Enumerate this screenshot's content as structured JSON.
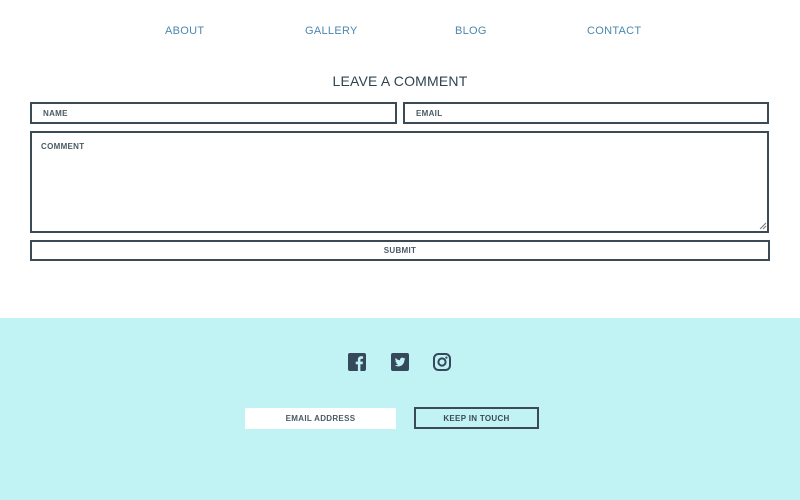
{
  "nav": {
    "items": [
      {
        "label": "ABOUT"
      },
      {
        "label": "GALLERY"
      },
      {
        "label": "BLOG"
      },
      {
        "label": "CONTACT"
      }
    ]
  },
  "comment_form": {
    "title": "LEAVE A COMMENT",
    "name_placeholder": "NAME",
    "email_placeholder": "EMAIL",
    "comment_placeholder": "COMMENT",
    "submit_label": "SUBMIT"
  },
  "footer": {
    "social_icons": [
      "facebook-icon",
      "twitter-icon",
      "instagram-icon"
    ],
    "email_placeholder": "EMAIL ADDRESS",
    "keep_in_touch_label": "KEEP IN TOUCH",
    "background_color": "#c2f3f4"
  },
  "colors": {
    "nav_link": "#4e87ad",
    "text_dark": "#2f4450",
    "border": "#3a4b55"
  }
}
